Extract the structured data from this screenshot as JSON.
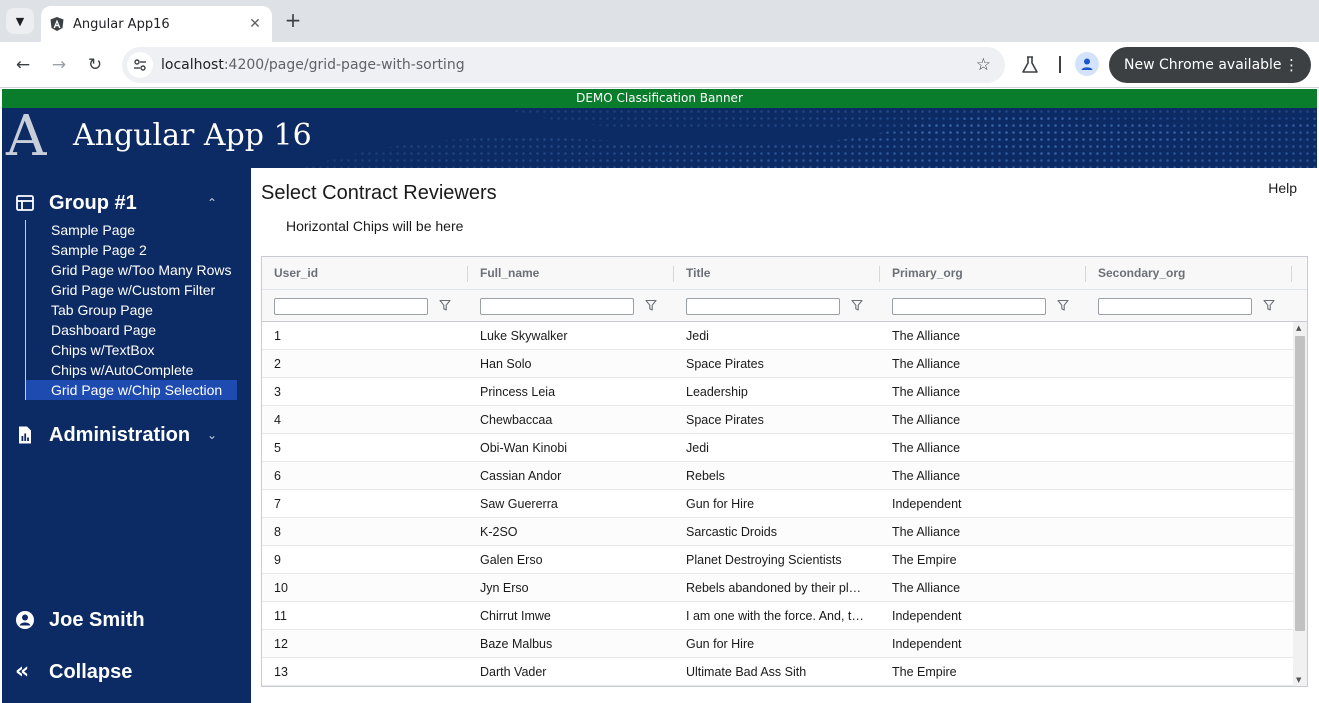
{
  "browser": {
    "tab_title": "Angular App16",
    "url_host": "localhost",
    "url_path": ":4200/page/grid-page-with-sorting",
    "update_label": "New Chrome available"
  },
  "app": {
    "classification_banner": "DEMO Classification Banner",
    "logo_letter": "A",
    "title": "Angular App 16"
  },
  "sidebar": {
    "group1": {
      "label": "Group #1",
      "items": [
        {
          "label": "Sample Page"
        },
        {
          "label": "Sample Page 2"
        },
        {
          "label": "Grid Page w/Too Many Rows"
        },
        {
          "label": "Grid Page w/Custom Filter"
        },
        {
          "label": "Tab Group Page"
        },
        {
          "label": "Dashboard Page"
        },
        {
          "label": "Chips w/TextBox"
        },
        {
          "label": "Chips w/AutoComplete"
        },
        {
          "label": "Grid Page w/Chip Selection",
          "active": true
        }
      ]
    },
    "group2": {
      "label": "Administration"
    },
    "user": {
      "label": "Joe Smith"
    },
    "collapse": {
      "label": "Collapse"
    }
  },
  "main": {
    "title": "Select Contract Reviewers",
    "help": "Help",
    "chips_placeholder": "Horizontal Chips will be here"
  },
  "grid": {
    "columns": [
      "User_id",
      "Full_name",
      "Title",
      "Primary_org",
      "Secondary_org"
    ],
    "rows": [
      [
        "1",
        "Luke Skywalker",
        "Jedi",
        "The Alliance",
        ""
      ],
      [
        "2",
        "Han Solo",
        "Space Pirates",
        "The Alliance",
        ""
      ],
      [
        "3",
        "Princess Leia",
        "Leadership",
        "The Alliance",
        ""
      ],
      [
        "4",
        "Chewbaccaa",
        "Space Pirates",
        "The Alliance",
        ""
      ],
      [
        "5",
        "Obi-Wan Kinobi",
        "Jedi",
        "The Alliance",
        ""
      ],
      [
        "6",
        "Cassian Andor",
        "Rebels",
        "The Alliance",
        ""
      ],
      [
        "7",
        "Saw Guererra",
        "Gun for Hire",
        "Independent",
        ""
      ],
      [
        "8",
        "K-2SO",
        "Sarcastic Droids",
        "The Alliance",
        ""
      ],
      [
        "9",
        "Galen Erso",
        "Planet Destroying Scientists",
        "The Empire",
        ""
      ],
      [
        "10",
        "Jyn Erso",
        "Rebels abandoned by their pla…",
        "The Alliance",
        ""
      ],
      [
        "11",
        "Chirrut Imwe",
        "I am one with the force. And, t…",
        "Independent",
        ""
      ],
      [
        "12",
        "Baze Malbus",
        "Gun for Hire",
        "Independent",
        ""
      ],
      [
        "13",
        "Darth Vader",
        "Ultimate Bad Ass Sith",
        "The Empire",
        ""
      ]
    ]
  },
  "colors": {
    "header_bg": "#0c2a63",
    "banner_green": "#0a7d2c",
    "active_item": "#1e4bb0"
  }
}
